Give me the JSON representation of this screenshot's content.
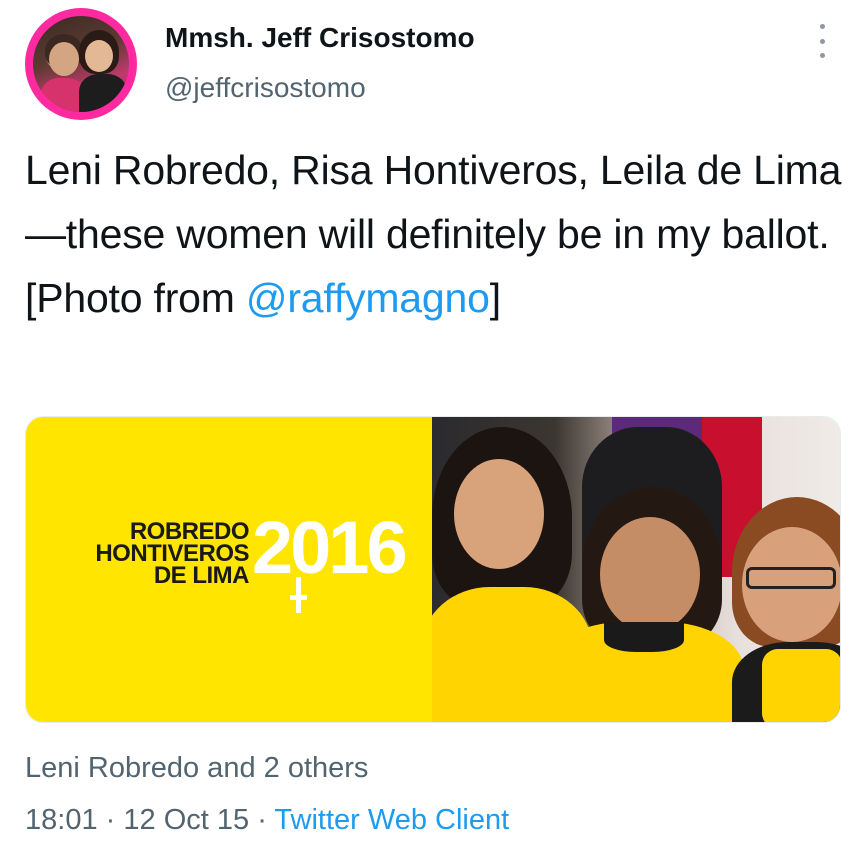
{
  "tweet": {
    "author": {
      "display_name": "Mmsh. Jeff Crisostomo",
      "handle": "@jeffcrisostomo"
    },
    "text_before": "Leni Robredo, Risa Hontiveros, Leila de Lima—these women will definitely be in my ballot. [Photo from ",
    "mention": "@raffymagno",
    "text_after": "]",
    "media": {
      "graphic_names": [
        "ROBREDO",
        "HONTIVEROS",
        "DE LIMA"
      ],
      "graphic_year": "2016"
    },
    "likes_line": "Leni Robredo and 2 others",
    "time": "18:01",
    "separator": "·",
    "date": "12 Oct 15",
    "client": "Twitter Web Client"
  },
  "colors": {
    "avatar_ring": "#ff2aa0",
    "link": "#1d9bf0",
    "muted": "#536471",
    "graphic_yellow": "#ffe500"
  },
  "icons": {
    "more": "more-vertical-icon"
  }
}
